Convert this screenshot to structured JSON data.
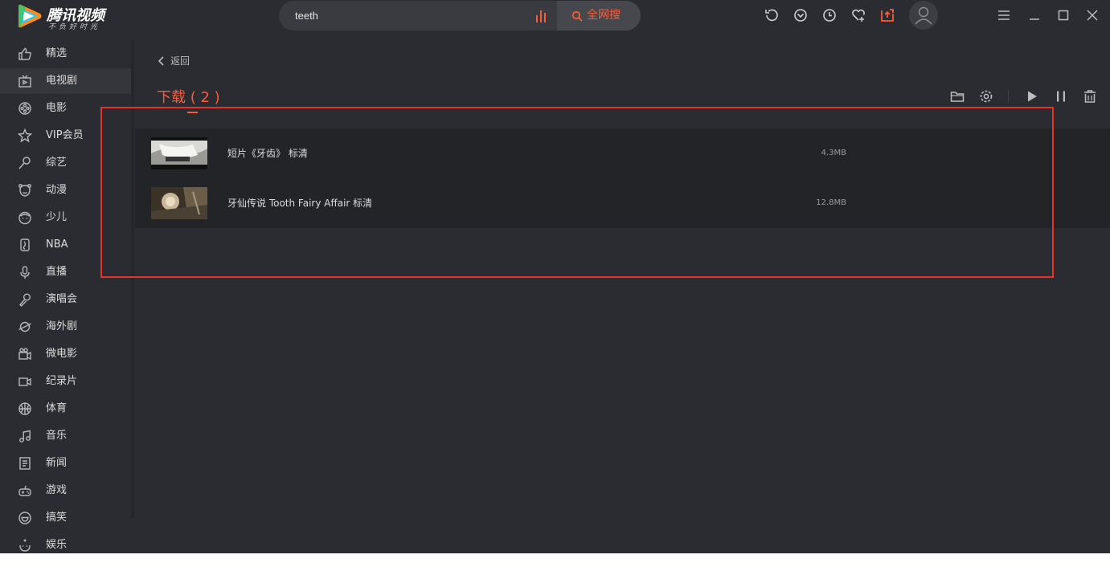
{
  "app": {
    "brand": "腾讯视频",
    "slogan": "不负好时光"
  },
  "search": {
    "query": "teeth",
    "button_label": "全网搜"
  },
  "toolbar_icons": [
    "history-icon",
    "download-icon",
    "clock-icon",
    "heart-icon",
    "upload-icon",
    "avatar-icon"
  ],
  "window_controls": [
    "menu-icon",
    "minimize-icon",
    "maximize-icon",
    "close-icon"
  ],
  "sidebar": {
    "active_index": 1,
    "items": [
      {
        "label": "精选",
        "icon": "thumb-up-icon"
      },
      {
        "label": "电视剧",
        "icon": "tv-icon"
      },
      {
        "label": "电影",
        "icon": "film-reel-icon"
      },
      {
        "label": "VIP会员",
        "icon": "star-icon"
      },
      {
        "label": "综艺",
        "icon": "magic-wand-icon"
      },
      {
        "label": "动漫",
        "icon": "cartoon-face-icon"
      },
      {
        "label": "少儿",
        "icon": "kid-face-icon"
      },
      {
        "label": "NBA",
        "icon": "nba-icon"
      },
      {
        "label": "直播",
        "icon": "microphone-icon"
      },
      {
        "label": "演唱会",
        "icon": "handheld-mic-icon"
      },
      {
        "label": "海外剧",
        "icon": "planet-icon"
      },
      {
        "label": "微电影",
        "icon": "camera-icon"
      },
      {
        "label": "纪录片",
        "icon": "video-camera-icon"
      },
      {
        "label": "体育",
        "icon": "basketball-icon"
      },
      {
        "label": "音乐",
        "icon": "music-note-icon"
      },
      {
        "label": "新闻",
        "icon": "newspaper-icon"
      },
      {
        "label": "游戏",
        "icon": "gamepad-icon"
      },
      {
        "label": "搞笑",
        "icon": "smile-icon"
      },
      {
        "label": "娱乐",
        "icon": "sparkle-face-icon"
      }
    ]
  },
  "main": {
    "back_label": "返回",
    "title": "下载 ( 2 )",
    "actions": [
      "folder-icon",
      "settings-icon",
      "play-icon",
      "pause-icon",
      "trash-icon"
    ],
    "downloads": [
      {
        "name": "短片《牙齿》 标清",
        "size": "4.3MB"
      },
      {
        "name": "牙仙传说 Tooth Fairy Affair 标清",
        "size": "12.8MB"
      }
    ]
  },
  "colors": {
    "accent": "#ff5a36",
    "background": "#2b2c31",
    "list_background": "#232428",
    "highlight_border": "#e8332c"
  }
}
